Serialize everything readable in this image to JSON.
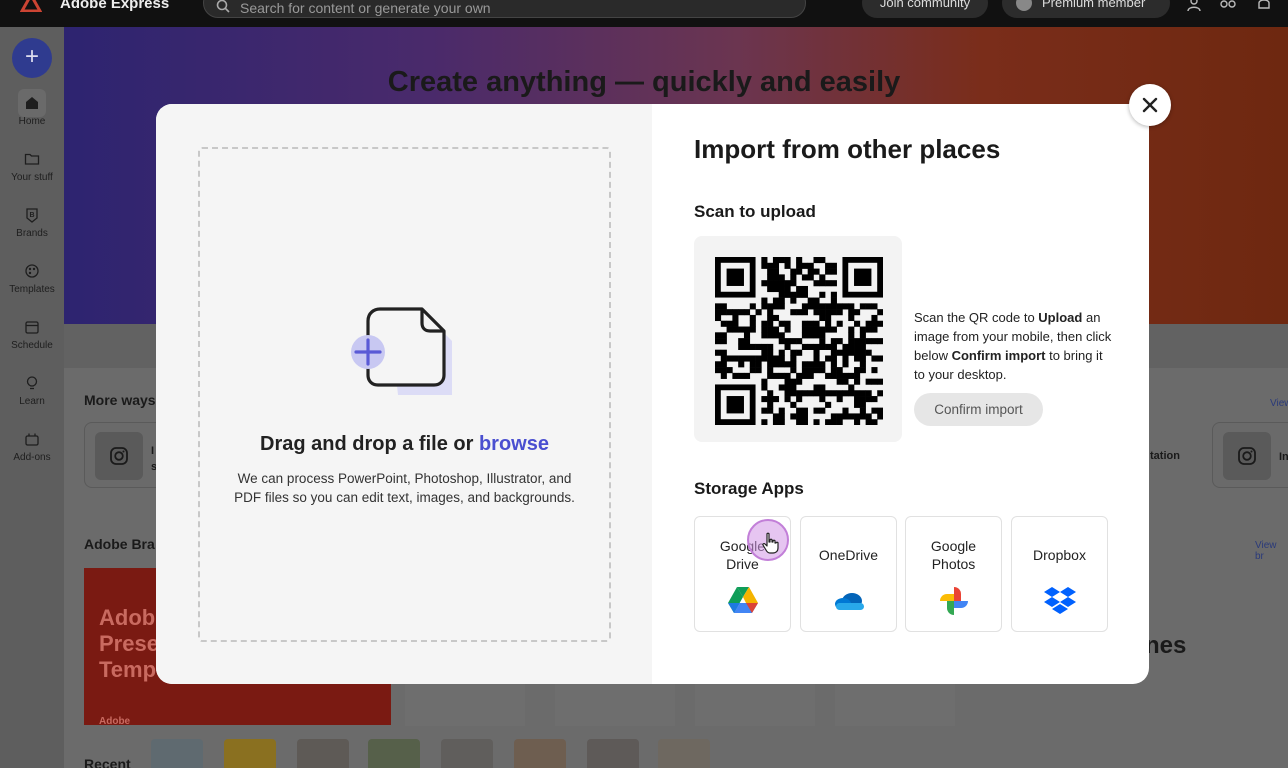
{
  "app": {
    "name": "Adobe Express",
    "search_placeholder": "Search for content or generate your own",
    "join_label": "Join community",
    "premium_label": "Premium member"
  },
  "sidebar": {
    "items": [
      {
        "label": "Home",
        "icon": "home-icon"
      },
      {
        "label": "Your stuff",
        "icon": "folder-icon"
      },
      {
        "label": "Brands",
        "icon": "brand-icon"
      },
      {
        "label": "Templates",
        "icon": "templates-icon"
      },
      {
        "label": "Schedule",
        "icon": "calendar-icon"
      },
      {
        "label": "Learn",
        "icon": "lightbulb-icon"
      },
      {
        "label": "Add-ons",
        "icon": "addons-icon"
      }
    ]
  },
  "background": {
    "hero_title": "Create anything — quickly and easily",
    "more_ways": "More ways",
    "brand_section": "Adobe Bra",
    "view": "View",
    "view_br": "View br",
    "card_text_left": "I\ns",
    "card_text_right": "tation",
    "card_text_far": "In",
    "red_card_title": "Adob\nPrese\nTemp",
    "red_card_sub": "Adobe",
    "big_text": "nes",
    "recent": "Recent"
  },
  "modal": {
    "drop_title_prefix": "Drag and drop a file or ",
    "browse_label": "browse",
    "drop_description": "We can process PowerPoint, Photoshop, Illustrator, and PDF files so you can edit text, images, and backgrounds.",
    "import_title": "Import from other places",
    "scan_heading": "Scan to upload",
    "scan_text": {
      "p1": "Scan the QR code to ",
      "b1": "Upload",
      "p2": " an image from your mobile, then click below ",
      "b2": "Confirm import",
      "p3": " to bring it to your desktop."
    },
    "confirm_label": "Confirm import",
    "storage_heading": "Storage Apps",
    "storage_apps": [
      {
        "name": "Google Drive",
        "icon": "google-drive-icon"
      },
      {
        "name": "OneDrive",
        "icon": "onedrive-icon"
      },
      {
        "name": "Google Photos",
        "icon": "google-photos-icon"
      },
      {
        "name": "Dropbox",
        "icon": "dropbox-icon"
      }
    ]
  },
  "colors": {
    "accent": "#4a4fd0",
    "overlay": "#5e5e5e"
  }
}
